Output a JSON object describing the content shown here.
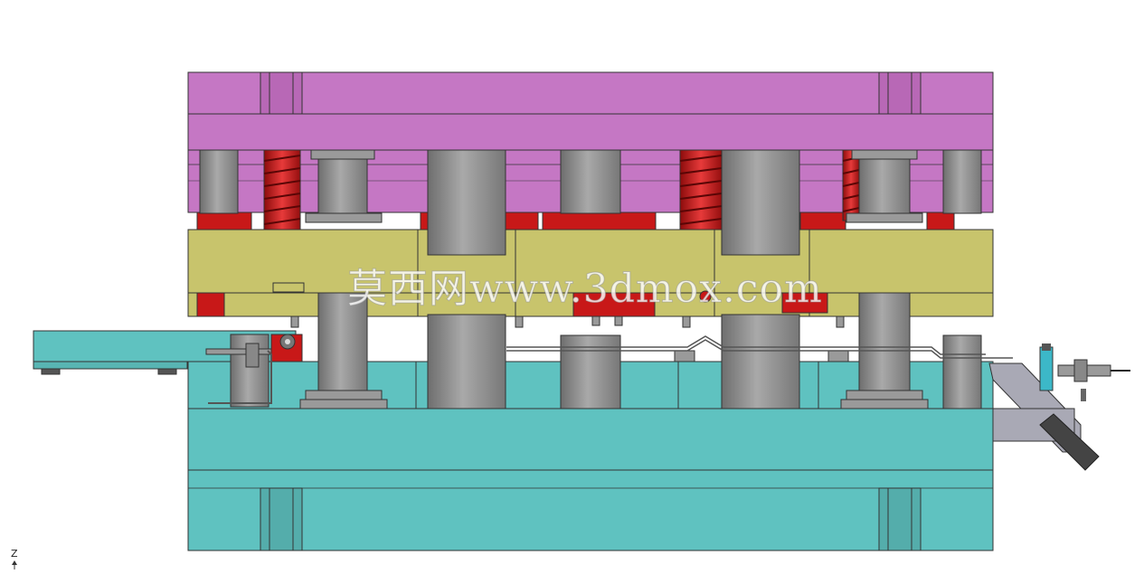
{
  "watermark": {
    "text": "莫西网www.3dmox.com"
  },
  "axis_triad": {
    "label": "Z"
  },
  "colors": {
    "background": "#ffffff",
    "upper_plate": "#c577c4",
    "stripper_plate": "#c8c46c",
    "lower_plate": "#5fc2c0",
    "guide_post": "#8a8a8a",
    "spring": "#d61f1f",
    "red_block": "#c81818",
    "outline": "#333333"
  }
}
